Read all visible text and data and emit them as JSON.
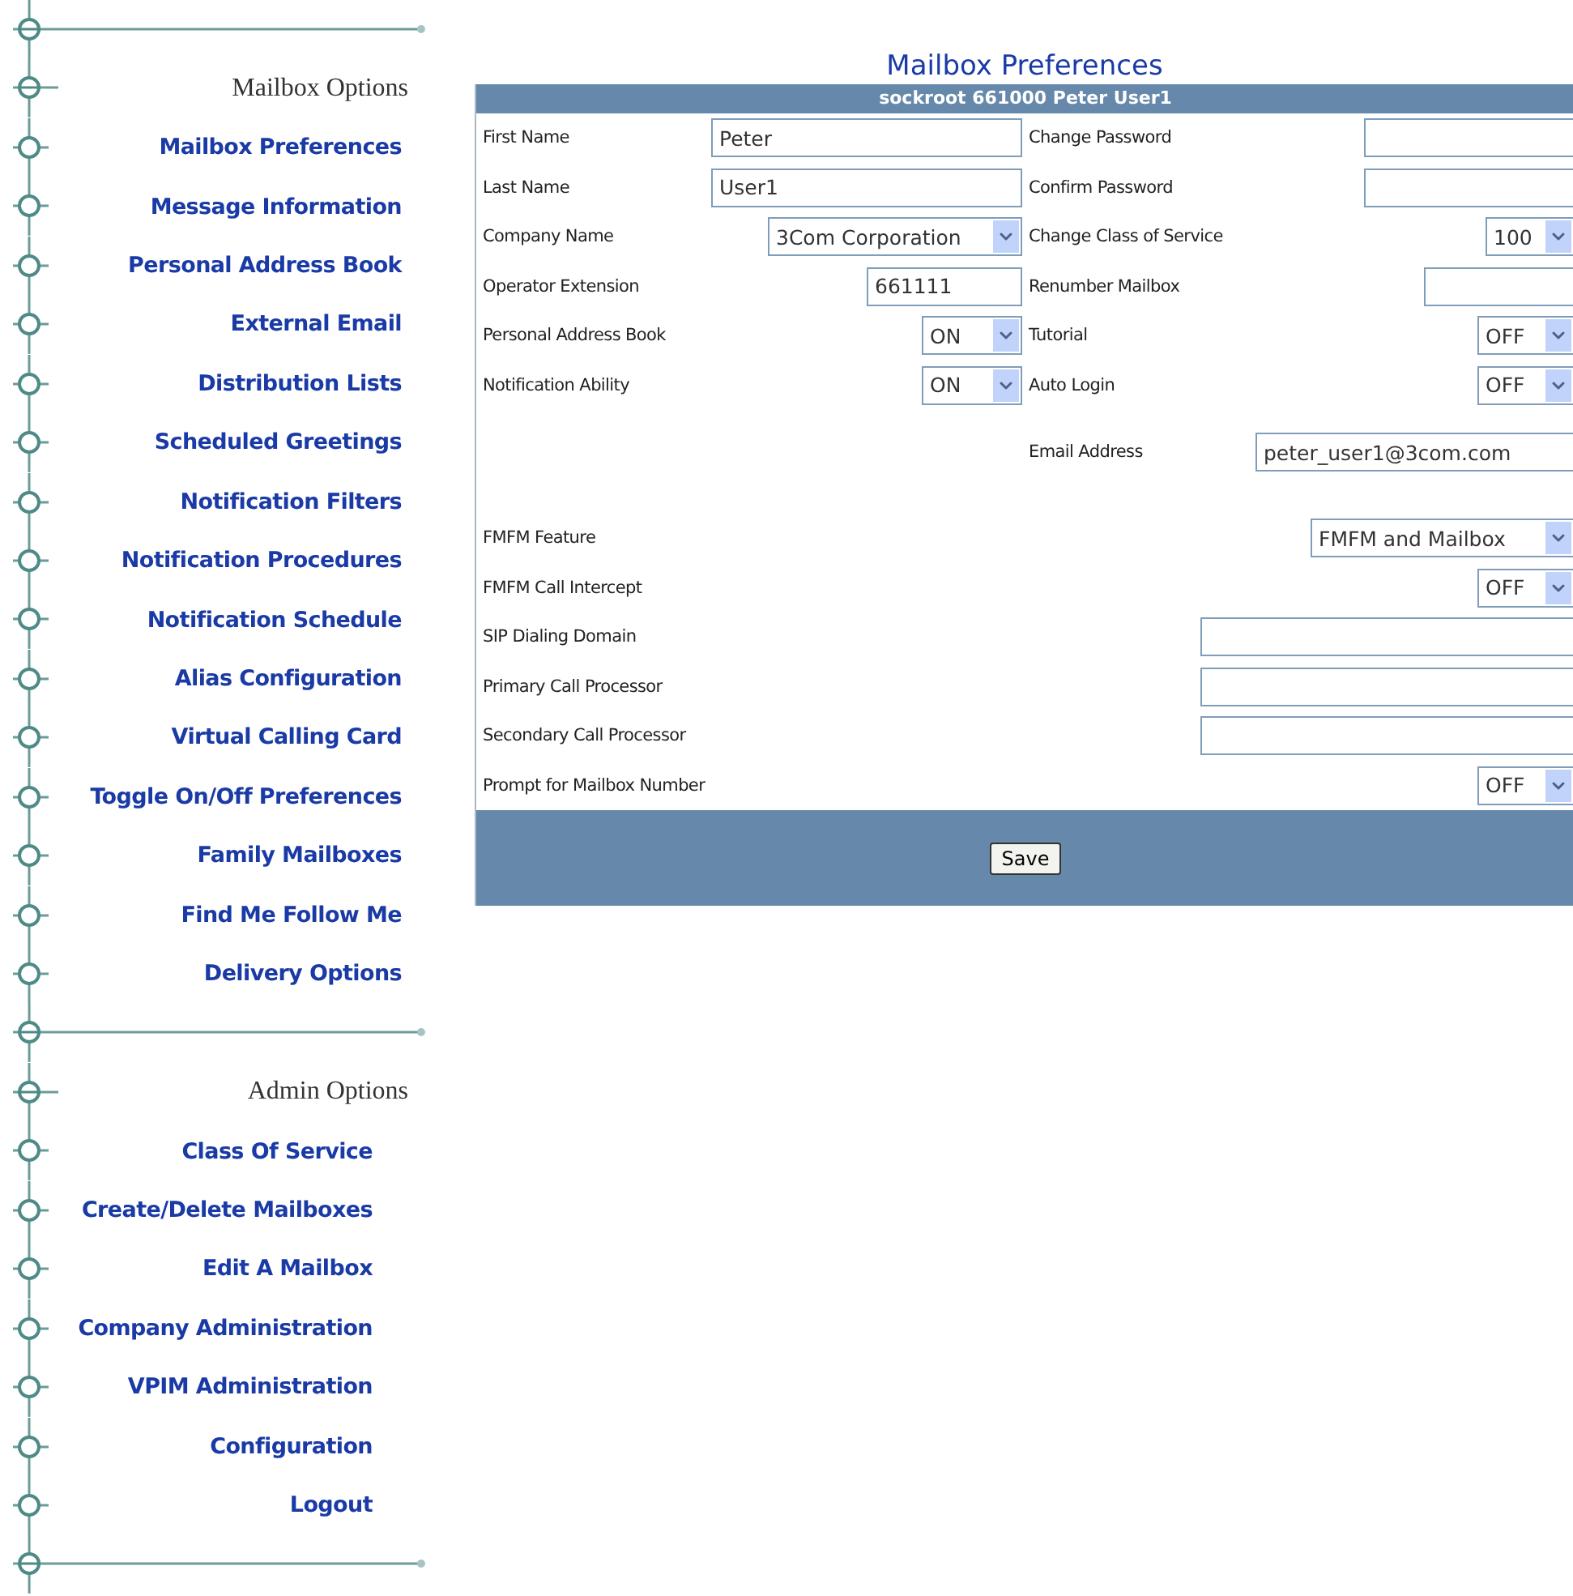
{
  "sidebar": {
    "items": [
      {
        "kind": "rule"
      },
      {
        "kind": "heading",
        "label": "Mailbox Options"
      },
      {
        "kind": "link",
        "label": "Mailbox Preferences"
      },
      {
        "kind": "link",
        "label": "Message Information"
      },
      {
        "kind": "link",
        "label": "Personal Address Book"
      },
      {
        "kind": "link",
        "label": "External Email"
      },
      {
        "kind": "link",
        "label": "Distribution Lists"
      },
      {
        "kind": "link",
        "label": "Scheduled Greetings"
      },
      {
        "kind": "link",
        "label": "Notification Filters"
      },
      {
        "kind": "link",
        "label": "Notification Procedures"
      },
      {
        "kind": "link",
        "label": "Notification Schedule"
      },
      {
        "kind": "link",
        "label": "Alias Configuration"
      },
      {
        "kind": "link",
        "label": "Virtual Calling Card"
      },
      {
        "kind": "link",
        "label": "Toggle On/Off Preferences"
      },
      {
        "kind": "link",
        "label": "Family Mailboxes"
      },
      {
        "kind": "link",
        "label": "Find Me Follow Me"
      },
      {
        "kind": "link",
        "label": "Delivery Options"
      },
      {
        "kind": "rule"
      },
      {
        "kind": "heading",
        "label": "Admin Options"
      },
      {
        "kind": "link",
        "label": "Class Of Service"
      },
      {
        "kind": "link",
        "label": "Create/Delete Mailboxes"
      },
      {
        "kind": "link",
        "label": "Edit A Mailbox"
      },
      {
        "kind": "link",
        "label": "Company Administration"
      },
      {
        "kind": "link",
        "label": "VPIM Administration"
      },
      {
        "kind": "link",
        "label": "Configuration"
      },
      {
        "kind": "link",
        "label": "Logout"
      },
      {
        "kind": "rule"
      }
    ]
  },
  "form": {
    "title": "Mailbox Preferences",
    "header": "sockroot 661000  Peter User1",
    "pair_rows": [
      {
        "left": {
          "label": "First Name",
          "kind": "text",
          "value": "Peter"
        },
        "right": {
          "label": "Change Password",
          "kind": "text"
        }
      },
      {
        "left": {
          "label": "Last Name",
          "kind": "text",
          "value": "User1"
        },
        "right": {
          "label": "Confirm Password",
          "kind": "text"
        }
      },
      {
        "left": {
          "label": "Company Name",
          "kind": "select",
          "value": "3Com Corporation"
        },
        "right": {
          "label": "Change Class of Service",
          "kind": "select",
          "value": "100"
        }
      },
      {
        "left": {
          "label": "Operator Extension",
          "kind": "text",
          "value": "661111"
        },
        "right": {
          "label": "Renumber Mailbox",
          "kind": "text"
        }
      },
      {
        "left": {
          "label": "Personal Address Book",
          "kind": "select",
          "value": "ON"
        },
        "right": {
          "label": "Tutorial",
          "kind": "select",
          "value": "OFF"
        }
      },
      {
        "left": {
          "label": "Notification Ability",
          "kind": "select",
          "value": "ON"
        },
        "right": {
          "label": "Auto Login",
          "kind": "select",
          "value": "OFF"
        }
      },
      {
        "right": {
          "label": "Email Address",
          "kind": "text",
          "value": "peter_user1@3com.com"
        }
      }
    ],
    "wide_rows": [
      {
        "label": "FMFM Feature",
        "kind": "select",
        "value": "FMFM and Mailbox"
      },
      {
        "label": "FMFM Call Intercept",
        "kind": "select",
        "value": "OFF"
      },
      {
        "label": "SIP Dialing Domain",
        "kind": "text"
      },
      {
        "label": "Primary Call Processor",
        "kind": "text"
      },
      {
        "label": "Secondary Call Processor",
        "kind": "text"
      },
      {
        "label": "Prompt for Mailbox Number",
        "kind": "select",
        "value": "OFF"
      }
    ],
    "save_button": "Save"
  }
}
